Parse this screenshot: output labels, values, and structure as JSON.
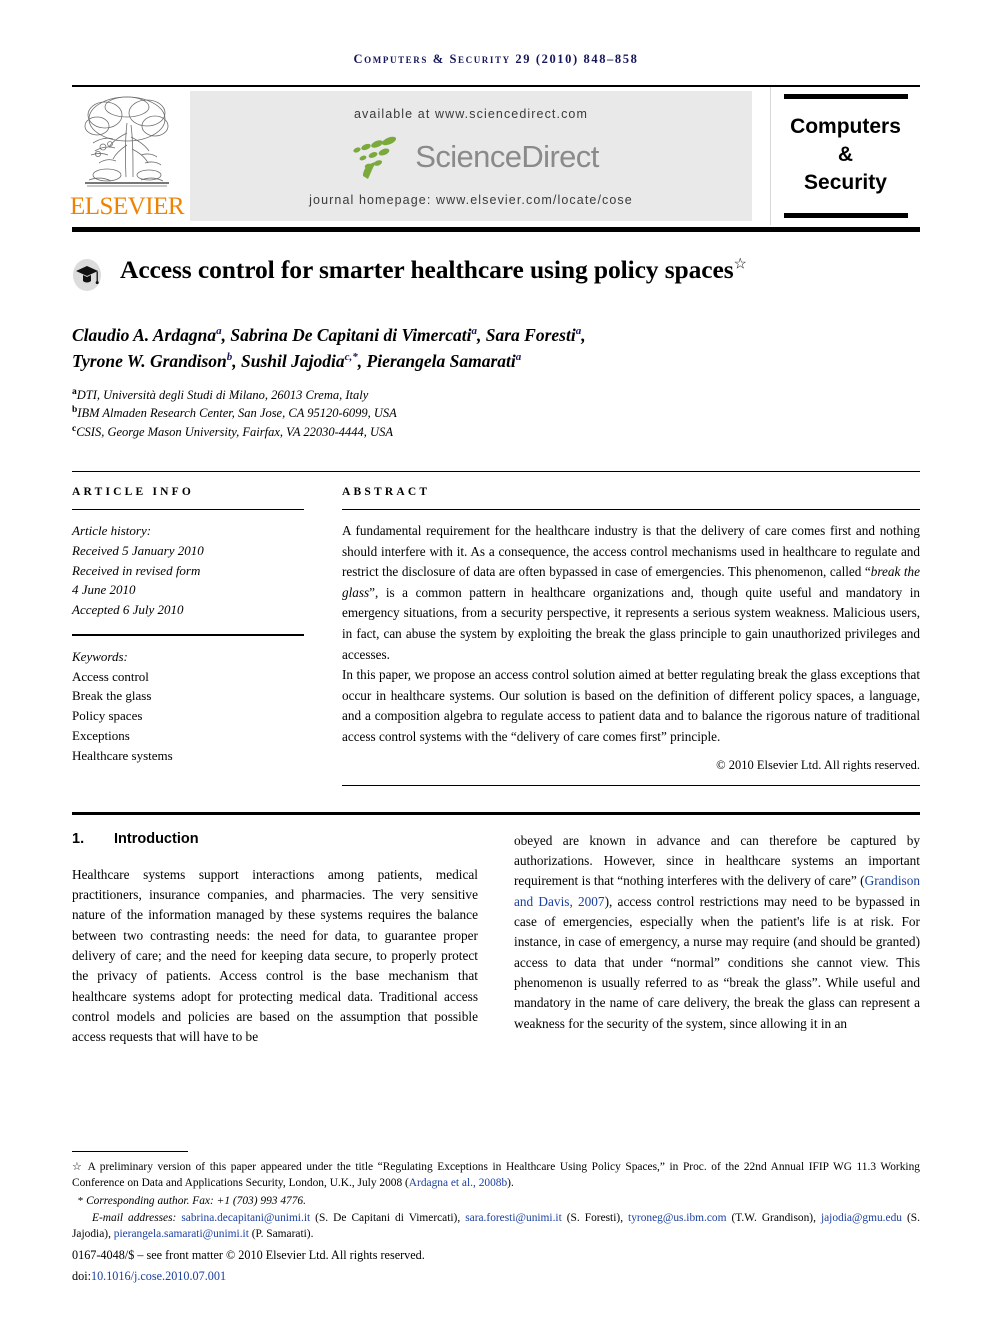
{
  "running_head": "Computers & Security 29 (2010) 848–858",
  "masthead": {
    "publisher_wordmark": "ELSEVIER",
    "available_at": "available at www.sciencedirect.com",
    "sciencedirect_wordmark": "ScienceDirect",
    "journal_homepage": "journal homepage: www.elsevier.com/locate/cose",
    "journal_title_line1": "Computers",
    "journal_title_line2": "&",
    "journal_title_line3": "Security",
    "colors": {
      "elsevier_orange": "#ef8200",
      "sciencedirect_green": "#7aa93c",
      "sciencedirect_gray": "#8a8a8a",
      "banner_background": "#e9e9e9",
      "running_head_navy": "#15155c",
      "link_blue": "#1a3fa0"
    }
  },
  "title": {
    "text": "Access control for smarter healthcare using policy spaces",
    "footnote_marker": "☆"
  },
  "authors": {
    "line1_parts": [
      {
        "name": "Claudio A. Ardagna",
        "mark": "a"
      },
      {
        "name": "Sabrina De Capitani di Vimercati",
        "mark": "a"
      },
      {
        "name": "Sara Foresti",
        "mark": "a"
      }
    ],
    "line2_parts": [
      {
        "name": "Tyrone W. Grandison",
        "mark": "b"
      },
      {
        "name": "Sushil Jajodia",
        "mark": "c,*"
      },
      {
        "name": "Pierangela Samarati",
        "mark": "a"
      }
    ],
    "affiliations": [
      {
        "mark": "a",
        "text": "DTI, Università degli Studi di Milano, 26013 Crema, Italy"
      },
      {
        "mark": "b",
        "text": "IBM Almaden Research Center, San Jose, CA 95120-6099, USA"
      },
      {
        "mark": "c",
        "text": "CSIS, George Mason University, Fairfax, VA 22030-4444, USA"
      }
    ]
  },
  "article_info": {
    "label": "ARTICLE INFO",
    "history_heading": "Article history:",
    "history_lines": [
      "Received 5 January 2010",
      "Received in revised form",
      "4 June 2010",
      "Accepted 6 July 2010"
    ],
    "keywords_heading": "Keywords:",
    "keywords": [
      "Access control",
      "Break the glass",
      "Policy spaces",
      "Exceptions",
      "Healthcare systems"
    ]
  },
  "abstract": {
    "label": "ABSTRACT",
    "paragraph1_pre": "A fundamental requirement for the healthcare industry is that the delivery of care comes first and nothing should interfere with it. As a consequence, the access control mechanisms used in healthcare to regulate and restrict the disclosure of data are often bypassed in case of emergencies. This phenomenon, called “",
    "paragraph1_em": "break the glass",
    "paragraph1_post": "”, is a common pattern in healthcare organizations and, though quite useful and mandatory in emergency situations, from a security perspective, it represents a serious system weakness. Malicious users, in fact, can abuse the system by exploiting the break the glass principle to gain unauthorized privileges and accesses.",
    "paragraph2": "In this paper, we propose an access control solution aimed at better regulating break the glass exceptions that occur in healthcare systems. Our solution is based on the definition of different policy spaces, a language, and a composition algebra to regulate access to patient data and to balance the rigorous nature of traditional access control systems with the “delivery of care comes first” principle.",
    "copyright": "© 2010 Elsevier Ltd. All rights reserved."
  },
  "body": {
    "section_number": "1.",
    "section_title": "Introduction",
    "left_paragraph": "Healthcare systems support interactions among patients, medical practitioners, insurance companies, and pharmacies. The very sensitive nature of the information managed by these systems requires the balance between two contrasting needs: the need for data, to guarantee proper delivery of care; and the need for keeping data secure, to properly protect the privacy of patients. Access control is the base mechanism that healthcare systems adopt for protecting medical data. Traditional access control models and policies are based on the assumption that possible access requests that will have to be",
    "right_pre": "obeyed are known in advance and can therefore be captured by authorizations. However, since in healthcare systems an important requirement is that “nothing interferes with the delivery of care” (",
    "right_citation": "Grandison and Davis, 2007",
    "right_post": "), access control restrictions may need to be bypassed in case of emergencies, especially when the patient's life is at risk. For instance, in case of emergency, a nurse may require (and should be granted) access to data that under “normal” conditions she cannot view. This phenomenon is usually referred to as “break the glass”. While useful and mandatory in the name of care delivery, the break the glass can represent a weakness for the security of the system, since allowing it in an"
  },
  "footnotes": {
    "star_marker": "☆",
    "star_pre": " A preliminary version of this paper appeared under the title “Regulating Exceptions in Healthcare Using Policy Spaces,” in Proc. of the 22nd Annual IFIP WG 11.3 Working Conference on Data and Applications Security, London, U.K., July 2008 (",
    "star_citation": "Ardagna et al., 2008b",
    "star_post": ").",
    "corresponding_marker": "*",
    "corresponding": "Corresponding author. Fax: +1 (703) 993 4776.",
    "email_label": "E-mail addresses:",
    "emails": [
      {
        "address": "sabrina.decapitani@unimi.it",
        "owner": "(S. De Capitani di Vimercati)"
      },
      {
        "address": "sara.foresti@unimi.it",
        "owner": "(S. Foresti)"
      },
      {
        "address": "tyroneg@us.ibm.com",
        "owner": "(T.W. Grandison)"
      },
      {
        "address": "jajodia@gmu.edu",
        "owner": "(S. Jajodia)"
      },
      {
        "address": "pierangela.samarati@unimi.it",
        "owner": "(P. Samarati)"
      }
    ],
    "issn_line": "0167-4048/$ – see front matter © 2010 Elsevier Ltd. All rights reserved.",
    "doi_label": "doi:",
    "doi_value": "10.1016/j.cose.2010.07.001"
  }
}
